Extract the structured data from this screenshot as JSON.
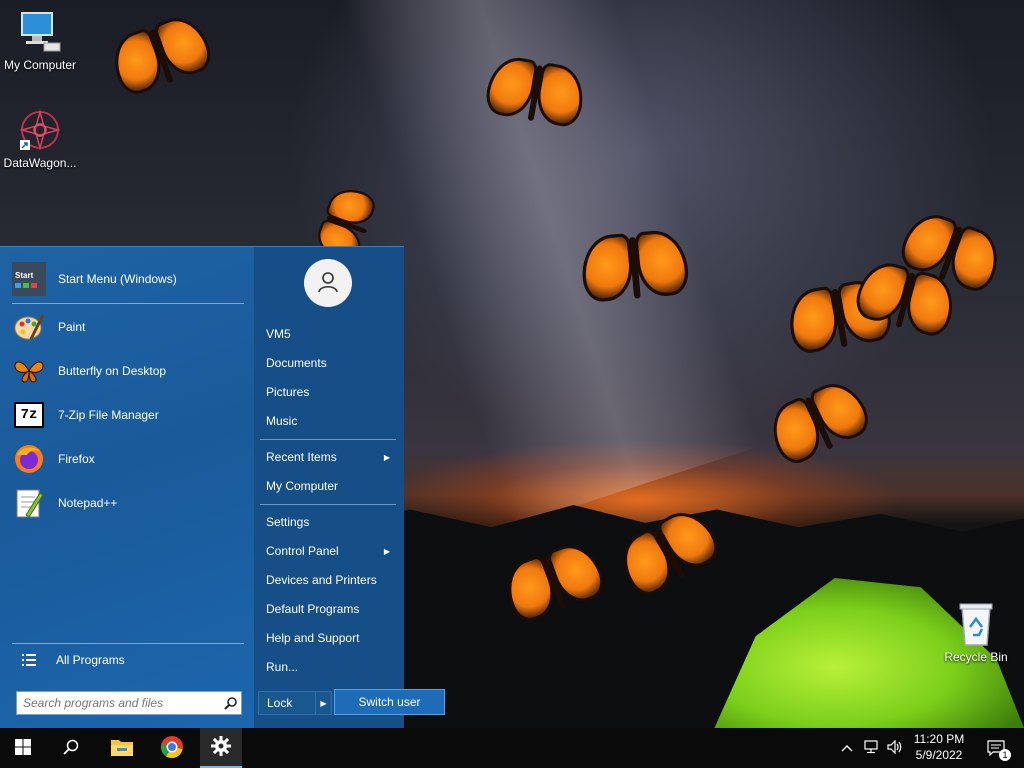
{
  "desktop": {
    "icons": [
      {
        "label": "My Computer",
        "icon": "computer-icon"
      },
      {
        "label": "DataWagon...",
        "icon": "datawagon-shortcut-icon"
      },
      {
        "label": "Recycle Bin",
        "icon": "recycle-bin-icon"
      }
    ]
  },
  "start_menu": {
    "programs": [
      {
        "label": "Start Menu (Windows)",
        "icon": "start-menu-app-icon"
      },
      {
        "label": "Paint",
        "icon": "paint-icon"
      },
      {
        "label": "Butterfly on Desktop",
        "icon": "butterfly-icon"
      },
      {
        "label": "7-Zip File Manager",
        "icon": "7zip-icon"
      },
      {
        "label": "Firefox",
        "icon": "firefox-icon"
      },
      {
        "label": "Notepad++",
        "icon": "notepadpp-icon"
      }
    ],
    "start_app_badge": "Start",
    "seven_zip_badge": "7z",
    "all_programs": "All Programs",
    "search_placeholder": "Search programs and files",
    "right_items": [
      {
        "label": "VM5"
      },
      {
        "label": "Documents"
      },
      {
        "label": "Pictures"
      },
      {
        "label": "Music"
      },
      {
        "label": "Recent Items",
        "submenu": true
      },
      {
        "label": "My Computer"
      },
      {
        "label": "Settings"
      },
      {
        "label": "Control Panel",
        "submenu": true
      },
      {
        "label": "Devices and Printers"
      },
      {
        "label": "Default Programs"
      },
      {
        "label": "Help and Support"
      },
      {
        "label": "Run..."
      }
    ],
    "lock_label": "Lock",
    "switch_user_label": "Switch user",
    "submenu_arrow": "▶"
  },
  "taskbar": {
    "buttons": [
      "windows-start-icon",
      "search-icon",
      "file-explorer-icon",
      "chrome-icon",
      "settings-gear-icon"
    ],
    "tray": {
      "chevron": "^",
      "time": "11:20 PM",
      "date": "5/9/2022",
      "notification_count": "1"
    }
  },
  "colors": {
    "start_menu_blue": "#1a5d9c",
    "taskbar": "#0a0a0a",
    "switch_user_highlight": "#1e6bb7"
  }
}
